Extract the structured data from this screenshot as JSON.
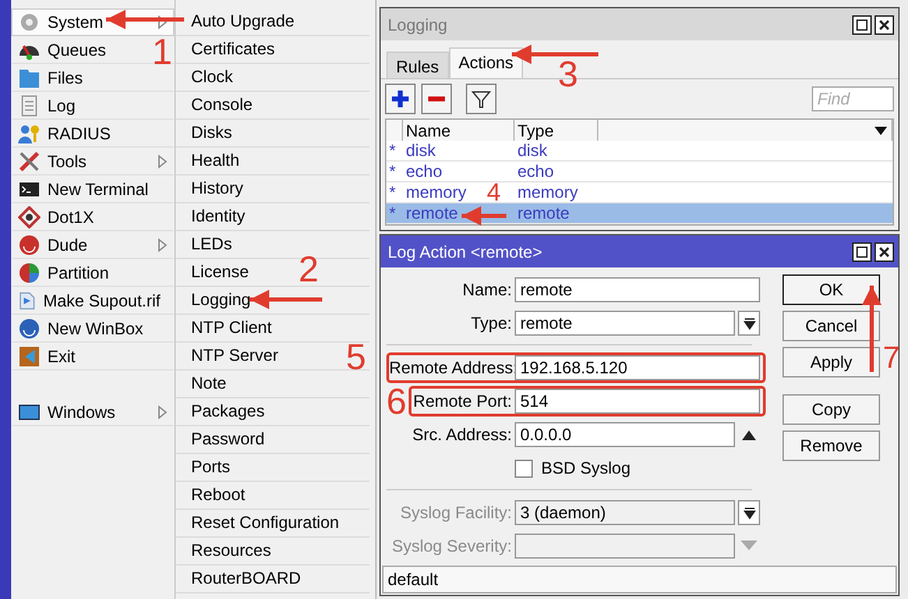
{
  "main_menu": [
    {
      "label": "System",
      "has_submenu": true,
      "selected": true
    },
    {
      "label": "Queues",
      "has_submenu": false,
      "selected": false
    },
    {
      "label": "Files",
      "has_submenu": false,
      "selected": false
    },
    {
      "label": "Log",
      "has_submenu": false,
      "selected": false
    },
    {
      "label": "RADIUS",
      "has_submenu": false,
      "selected": false
    },
    {
      "label": "Tools",
      "has_submenu": true,
      "selected": false
    },
    {
      "label": "New Terminal",
      "has_submenu": false,
      "selected": false
    },
    {
      "label": "Dot1X",
      "has_submenu": false,
      "selected": false
    },
    {
      "label": "Dude",
      "has_submenu": true,
      "selected": false
    },
    {
      "label": "Partition",
      "has_submenu": false,
      "selected": false
    },
    {
      "label": "Make Supout.rif",
      "has_submenu": false,
      "selected": false
    },
    {
      "label": "New WinBox",
      "has_submenu": false,
      "selected": false
    },
    {
      "label": "Exit",
      "has_submenu": false,
      "selected": false
    }
  ],
  "windows_menu": {
    "label": "Windows",
    "has_submenu": true
  },
  "submenu": [
    "Auto Upgrade",
    "Certificates",
    "Clock",
    "Console",
    "Disks",
    "Health",
    "History",
    "Identity",
    "LEDs",
    "License",
    "Logging",
    "NTP Client",
    "NTP Server",
    "Note",
    "Packages",
    "Password",
    "Ports",
    "Reboot",
    "Reset Configuration",
    "Resources",
    "RouterBOARD"
  ],
  "logging_window": {
    "title": "Logging",
    "tabs": [
      {
        "label": "Rules",
        "selected": false
      },
      {
        "label": "Actions",
        "selected": true
      }
    ],
    "find_placeholder": "Find",
    "columns": [
      "Name",
      "Type"
    ],
    "rows": [
      {
        "marker": "*",
        "name": "disk",
        "type": "disk",
        "selected": false
      },
      {
        "marker": "*",
        "name": "echo",
        "type": "echo",
        "selected": false
      },
      {
        "marker": "*",
        "name": "memory",
        "type": "memory",
        "selected": false
      },
      {
        "marker": "*",
        "name": "remote",
        "type": "remote",
        "selected": true
      }
    ]
  },
  "log_action_window": {
    "title": "Log Action <remote>",
    "fields": [
      {
        "kind": "text",
        "label": "Name:",
        "value": "remote",
        "disabled": false,
        "highlighted": false
      },
      {
        "kind": "select",
        "label": "Type:",
        "value": "remote",
        "disabled": false,
        "highlighted": false
      },
      {
        "kind": "separator"
      },
      {
        "kind": "text",
        "label": "Remote Address:",
        "value": "192.168.5.120",
        "disabled": false,
        "highlighted": true
      },
      {
        "kind": "text",
        "label": "Remote Port:",
        "value": "514",
        "disabled": false,
        "highlighted": true
      },
      {
        "kind": "spin",
        "label": "Src. Address:",
        "value": "0.0.0.0",
        "disabled": false,
        "highlighted": false
      },
      {
        "kind": "checkbox",
        "label": "BSD Syslog",
        "checked": false
      },
      {
        "kind": "separator"
      },
      {
        "kind": "select",
        "label": "Syslog Facility:",
        "value": "3 (daemon)",
        "disabled": true,
        "highlighted": false
      },
      {
        "kind": "select",
        "label": "Syslog Severity:",
        "disabled": true,
        "highlighted": false
      }
    ],
    "buttons": [
      {
        "label": "OK",
        "default": true
      },
      {
        "label": "Cancel",
        "default": false
      },
      {
        "label": "Apply",
        "default": false
      },
      {
        "label": "Copy",
        "default": false
      },
      {
        "label": "Remove",
        "default": false
      }
    ],
    "status": "default"
  },
  "annotations": [
    "1",
    "2",
    "3",
    "4",
    "5",
    "6",
    "7"
  ]
}
